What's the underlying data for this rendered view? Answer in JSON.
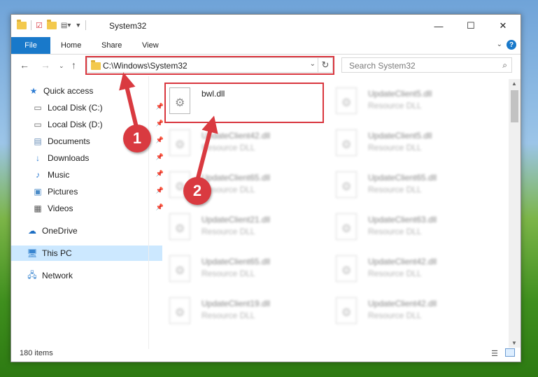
{
  "window": {
    "title": "System32",
    "controls": {
      "minimize": "—",
      "maximize": "☐",
      "close": "✕"
    }
  },
  "ribbon": {
    "file_tab": "File",
    "tabs": [
      "Home",
      "Share",
      "View"
    ],
    "help": "?"
  },
  "navbar": {
    "address": "C:\\Windows\\System32",
    "search_placeholder": "Search System32"
  },
  "sidebar": {
    "items": [
      {
        "label": "Quick access",
        "icon": "star-icon"
      },
      {
        "label": "Local Disk (C:)",
        "icon": "drive-icon"
      },
      {
        "label": "Local Disk (D:)",
        "icon": "drive-icon"
      },
      {
        "label": "Documents",
        "icon": "documents-icon"
      },
      {
        "label": "Downloads",
        "icon": "downloads-icon"
      },
      {
        "label": "Music",
        "icon": "music-icon"
      },
      {
        "label": "Pictures",
        "icon": "pictures-icon"
      },
      {
        "label": "Videos",
        "icon": "videos-icon"
      },
      {
        "label": "OneDrive",
        "icon": "cloud-icon"
      },
      {
        "label": "This PC",
        "icon": "computer-icon"
      },
      {
        "label": "Network",
        "icon": "network-icon"
      }
    ],
    "selected": "This PC"
  },
  "files": {
    "highlighted": {
      "name": "bwl.dll",
      "type": ""
    },
    "left_column": [
      {
        "name": "UpdateClient42.dll",
        "type": "Resource DLL"
      },
      {
        "name": "UpdateClient65.dll",
        "type": "Resource DLL"
      },
      {
        "name": "UpdateClient21.dll",
        "type": "Resource DLL"
      },
      {
        "name": "UpdateClient65.dll",
        "type": "Resource DLL"
      },
      {
        "name": "UpdateClient19.dll",
        "type": "Resource DLL"
      }
    ],
    "right_column": [
      {
        "name": "UpdateClient5.dll",
        "type": "Resource DLL"
      },
      {
        "name": "UpdateClient5.dll",
        "type": "Resource DLL"
      },
      {
        "name": "UpdateClient65.dll",
        "type": "Resource DLL"
      },
      {
        "name": "UpdateClient63.dll",
        "type": "Resource DLL"
      },
      {
        "name": "UpdateClient42.dll",
        "type": "Resource DLL"
      },
      {
        "name": "UpdateClient42.dll",
        "type": "Resource DLL"
      }
    ]
  },
  "status": {
    "item_count": "180 items"
  },
  "annotations": {
    "step1": "1",
    "step2": "2",
    "color": "#d93a40"
  }
}
